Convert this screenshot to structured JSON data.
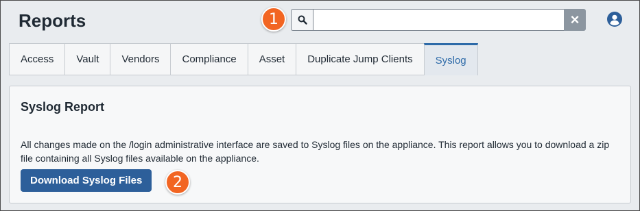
{
  "header": {
    "title": "Reports",
    "search": {
      "value": "",
      "placeholder": ""
    },
    "clear_label": "×"
  },
  "callouts": [
    "1",
    "2"
  ],
  "tabs": [
    {
      "label": "Access",
      "active": false
    },
    {
      "label": "Vault",
      "active": false
    },
    {
      "label": "Vendors",
      "active": false
    },
    {
      "label": "Compliance",
      "active": false
    },
    {
      "label": "Asset",
      "active": false
    },
    {
      "label": "Duplicate Jump Clients",
      "active": false
    },
    {
      "label": "Syslog",
      "active": true
    }
  ],
  "panel": {
    "title": "Syslog Report",
    "description": "All changes made on the /login administrative interface are saved to Syslog files on the appliance. This report allows you to download a zip file containing all Syslog files available on the appliance.",
    "button_label": "Download Syslog Files"
  },
  "icons": {
    "search": "search-icon",
    "clear": "close-icon",
    "user": "user-icon"
  },
  "colors": {
    "accent": "#2d6aa8",
    "button": "#2d5f9a",
    "callout": "#f26522",
    "clear_button": "#8c96a0"
  }
}
